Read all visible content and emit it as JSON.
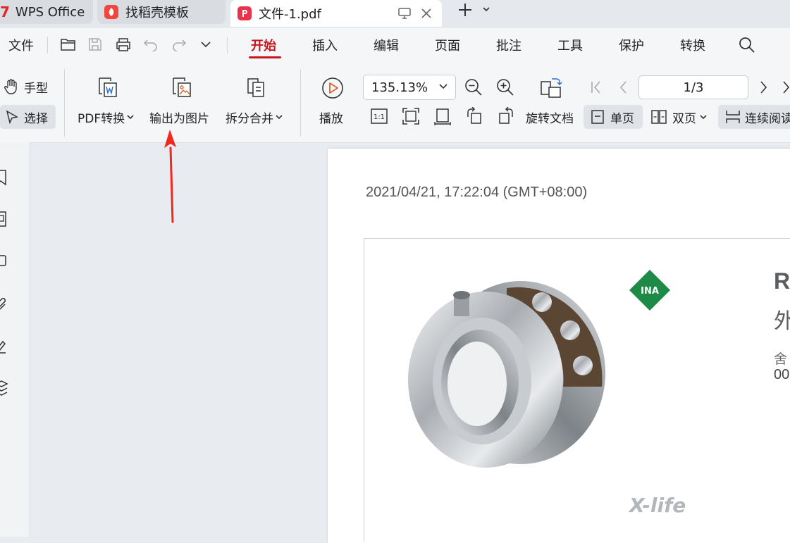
{
  "tabs": [
    {
      "label": "WPS Office",
      "icon": "wps-logo-icon",
      "active": false
    },
    {
      "label": "找稻壳模板",
      "icon": "docer-icon",
      "active": false
    },
    {
      "label": "文件-1.pdf",
      "icon": "pdf-icon",
      "active": true
    }
  ],
  "menu": {
    "file_label": "文件",
    "items": [
      "开始",
      "插入",
      "编辑",
      "页面",
      "批注",
      "工具",
      "保护",
      "转换"
    ],
    "active": "开始"
  },
  "toolbar": {
    "hand_label": "手型",
    "select_label": "选择",
    "pdf_convert_label": "PDF转换",
    "export_image_label": "输出为图片",
    "split_merge_label": "拆分合并",
    "play_label": "播放",
    "zoom_value": "135.13%",
    "page_value": "1/3",
    "rotate_doc_label": "旋转文档",
    "single_page_label": "单页",
    "double_page_label": "双页",
    "continuous_label": "连续阅读"
  },
  "document": {
    "timestamp": "2021/04/21, 17:22:04 (GMT+08:00)",
    "logo_text": "INA",
    "brand_text": "X-life",
    "partial_title": "R",
    "partial_subtitle": "外",
    "partial_line1": "舍",
    "partial_line2": "00"
  },
  "colors": {
    "accent": "#c8161d",
    "annotation_arrow": "#f0281e",
    "ina_green": "#1d8a45"
  }
}
